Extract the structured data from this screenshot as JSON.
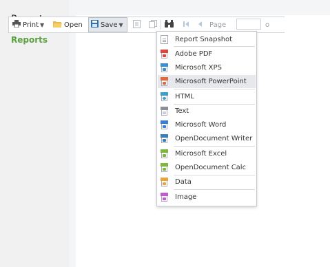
{
  "sidebar": {
    "title": "Reports",
    "link": "Reports"
  },
  "toolbar": {
    "print_label": "Print",
    "open_label": "Open",
    "save_label": "Save",
    "page_label": "Page",
    "page_value": "",
    "trailing_fragment": "o"
  },
  "save_menu": {
    "items": [
      {
        "label": "Report Snapshot",
        "icon": "report-snapshot-icon",
        "color": "#9fa7b1"
      },
      {
        "label": "Adobe PDF",
        "icon": "pdf-icon",
        "color": "#e0443a"
      },
      {
        "label": "Microsoft XPS",
        "icon": "xps-icon",
        "color": "#3a8fd6"
      },
      {
        "label": "Microsoft PowerPoint",
        "icon": "powerpoint-icon",
        "color": "#e06a3a"
      },
      {
        "label": "HTML",
        "icon": "html-icon",
        "color": "#3aa0c8"
      },
      {
        "label": "Text",
        "icon": "text-icon",
        "color": "#8a8f96"
      },
      {
        "label": "Microsoft Word",
        "icon": "word-icon",
        "color": "#3a7fd6"
      },
      {
        "label": "OpenDocument Writer",
        "icon": "odt-icon",
        "color": "#3a7fb8"
      },
      {
        "label": "Microsoft Excel",
        "icon": "excel-icon",
        "color": "#7cb83a"
      },
      {
        "label": "OpenDocument Calc",
        "icon": "ods-icon",
        "color": "#7cb83a"
      },
      {
        "label": "Data",
        "icon": "data-icon",
        "color": "#e8a43a"
      },
      {
        "label": "Image",
        "icon": "image-icon",
        "color": "#c05ad0"
      }
    ],
    "highlighted": "Microsoft PowerPoint"
  },
  "colors": {
    "accent_green": "#5aa140",
    "sidebar_bg": "#f1f1f1",
    "toolbar_border": "#cfd3d8"
  }
}
